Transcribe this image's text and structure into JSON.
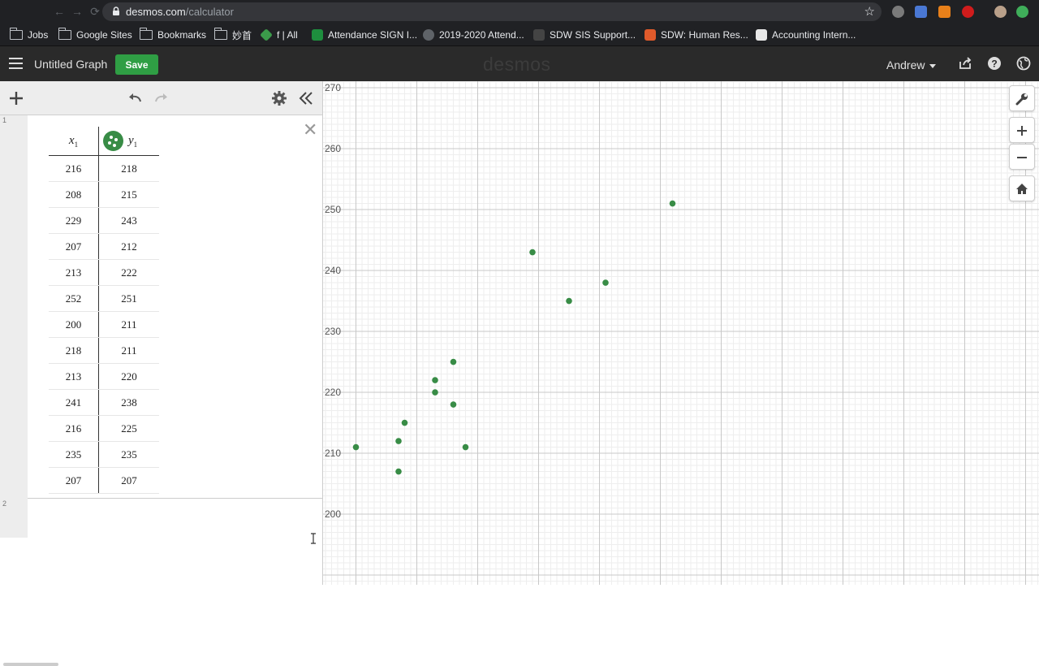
{
  "browser": {
    "url_domain": "desmos.com",
    "url_path": "/calculator",
    "bookmarks": [
      {
        "label": "Jobs",
        "icon": "folder-icon"
      },
      {
        "label": "Google Sites",
        "icon": "folder-icon"
      },
      {
        "label": "Bookmarks",
        "icon": "folder-icon"
      },
      {
        "label": "妙首",
        "icon": "folder-icon"
      },
      {
        "label": "f | All",
        "icon": "site-icon"
      },
      {
        "label": "Attendance SIGN I...",
        "icon": "sheets-icon"
      },
      {
        "label": "2019-2020 Attend...",
        "icon": "globe-icon"
      },
      {
        "label": "SDW SIS Support...",
        "icon": "site-icon"
      },
      {
        "label": "SDW: Human Res...",
        "icon": "blogger-icon"
      },
      {
        "label": "Accounting Intern...",
        "icon": "site-icon"
      }
    ]
  },
  "header": {
    "title": "Untitled Graph",
    "save_label": "Save",
    "logo": "desmos",
    "user": "Andrew"
  },
  "expressions": {
    "line_numbers": [
      "1",
      "2"
    ],
    "table": {
      "col1_var": "x",
      "col1_sub": "1",
      "col2_var": "y",
      "col2_sub": "1",
      "point_color": "#388c46",
      "rows": [
        [
          "216",
          "218"
        ],
        [
          "208",
          "215"
        ],
        [
          "229",
          "243"
        ],
        [
          "207",
          "212"
        ],
        [
          "213",
          "222"
        ],
        [
          "252",
          "251"
        ],
        [
          "200",
          "211"
        ],
        [
          "218",
          "211"
        ],
        [
          "213",
          "220"
        ],
        [
          "241",
          "238"
        ],
        [
          "216",
          "225"
        ],
        [
          "235",
          "235"
        ],
        [
          "207",
          "207"
        ]
      ]
    }
  },
  "chart_data": {
    "type": "scatter",
    "series": [
      {
        "color": "#388c46",
        "points": [
          [
            216,
            218
          ],
          [
            208,
            215
          ],
          [
            229,
            243
          ],
          [
            207,
            212
          ],
          [
            213,
            222
          ],
          [
            252,
            251
          ],
          [
            200,
            211
          ],
          [
            218,
            211
          ],
          [
            213,
            220
          ],
          [
            241,
            238
          ],
          [
            216,
            225
          ],
          [
            235,
            235
          ],
          [
            207,
            207
          ]
        ]
      }
    ],
    "ylim": [
      198,
      271
    ],
    "ytick_labels": [
      "270",
      "260",
      "250",
      "240",
      "230",
      "220",
      "210",
      "200"
    ],
    "grid": true
  }
}
